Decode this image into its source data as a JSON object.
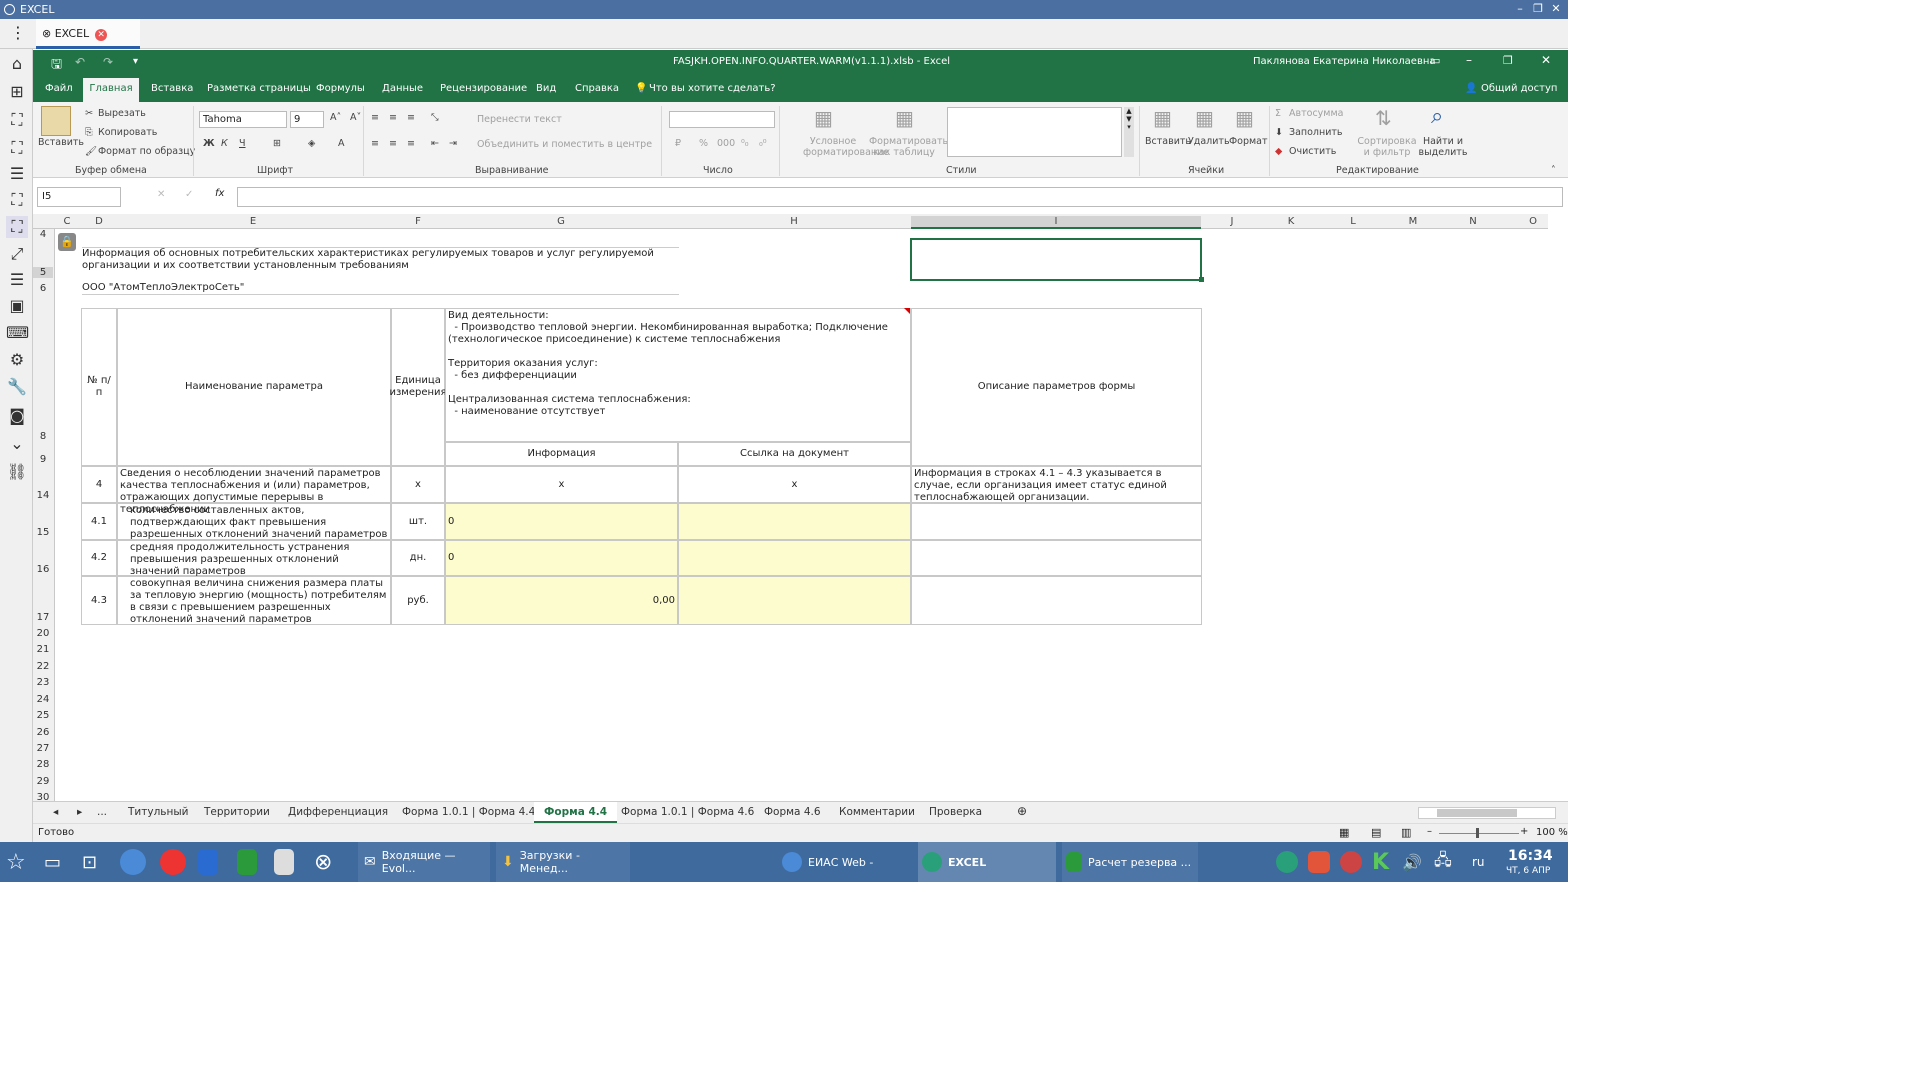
{
  "window": {
    "title": "EXCEL"
  },
  "tab": {
    "label": "EXCEL"
  },
  "excel": {
    "filename": "FASJKH.OPEN.INFO.QUARTER.WARM(v1.1.1).xlsb  -  Excel",
    "user": "Паклянова Екатерина Николаевна",
    "menu": [
      "Файл",
      "Главная",
      "Вставка",
      "Разметка страницы",
      "Формулы",
      "Данные",
      "Рецензирование",
      "Вид",
      "Справка"
    ],
    "tell_me": "Что вы хотите сделать?",
    "share": "Общий доступ"
  },
  "ribbon": {
    "paste": "Вставить",
    "cut": "Вырезать",
    "copy": "Копировать",
    "format_painter": "Формат по образцу",
    "g_clipboard": "Буфер обмена",
    "font_name": "Tahoma",
    "font_size": "9",
    "g_font": "Шрифт",
    "wrap": "Перенести текст",
    "merge": "Объединить и поместить в центре",
    "g_align": "Выравнивание",
    "g_number": "Число",
    "cond": "Условное",
    "cond2": "форматирование",
    "asTable": "Форматировать",
    "asTable2": "как таблицу",
    "g_styles": "Стили",
    "insert": "Вставить",
    "delete": "Удалить",
    "format": "Формат",
    "g_cells": "Ячейки",
    "autosum": "Автосумма",
    "fill": "Заполнить",
    "clear": "Очистить",
    "sort": "Сортировка",
    "sort2": "и фильтр",
    "find": "Найти и",
    "find2": "выделить",
    "g_edit": "Редактирование"
  },
  "formula_bar": {
    "name_box": "I5",
    "formula": ""
  },
  "columns": [
    "C",
    "D",
    "E",
    "F",
    "G",
    "H",
    "I",
    "J",
    "K",
    "L",
    "M",
    "N",
    "O"
  ],
  "rows": [
    "4",
    "5",
    "6",
    "8",
    "9",
    "14",
    "15",
    "16",
    "17",
    "20",
    "21",
    "22",
    "23",
    "24",
    "25",
    "26",
    "27",
    "28",
    "29",
    "30"
  ],
  "sheet": {
    "info_title": "Информация об основных потребительских характеристиках регулируемых товаров и услуг регулируемой организации и их соответствии установленным требованиям",
    "org": "ООО \"АтомТеплоЭлектроСеть\"",
    "h_num": "№ п/п",
    "h_name": "Наименование параметра",
    "h_unit": "Единица измерения",
    "h_activity": "Вид деятельности:\n  - Производство тепловой энергии. Некомбинированная выработка; Подключение (технологическое присоединение) к системе теплоснабжения\n\nТерритория оказания услуг:\n  - без дифференциации\n\nЦентрализованная система теплоснабжения:\n  - наименование отсутствует",
    "h_desc": "Описание параметров формы",
    "h_info": "Информация",
    "h_link": "Ссылка на документ",
    "rows": [
      {
        "num": "4",
        "name": "Сведения о несоблюдении значений параметров качества теплоснабжения и (или) параметров, отражающих допустимые перерывы в теплоснабжении",
        "unit": "x",
        "info": "x",
        "link": "x",
        "desc": "Информация в строках 4.1 – 4.3 указывается в случае, если организация имеет статус единой теплоснабжающей организации."
      },
      {
        "num": "4.1",
        "name": "количество составленных актов, подтверждающих факт превышения разрешенных отклонений значений параметров",
        "unit": "шт.",
        "info": "0",
        "link": "",
        "desc": ""
      },
      {
        "num": "4.2",
        "name": "средняя продолжительность устранения превышения разрешенных отклонений значений параметров",
        "unit": "дн.",
        "info": "0",
        "link": "",
        "desc": ""
      },
      {
        "num": "4.3",
        "name": "совокупная величина снижения размера платы за тепловую энергию (мощность) потребителям в связи с превышением разрешенных отклонений значений параметров",
        "unit": "руб.",
        "info": "0,00",
        "link": "",
        "desc": ""
      }
    ]
  },
  "sheet_tabs": [
    "...",
    "Титульный",
    "Территории",
    "Дифференциация",
    "Форма 1.0.1 | Форма 4.4",
    "Форма 4.4",
    "Форма 1.0.1 | Форма 4.6",
    "Форма 4.6",
    "Комментарии",
    "Проверка"
  ],
  "status": {
    "ready": "Готово",
    "zoom": "100 %"
  },
  "taskbar": {
    "items": [
      "Входящие — Evol...",
      "Загрузки - Менед...",
      "ЕИАС Web -",
      "EXCEL",
      "Расчет резерва ..."
    ],
    "lang": "ru",
    "time": "16:34",
    "date": "ЧТ, 6 АПР"
  }
}
